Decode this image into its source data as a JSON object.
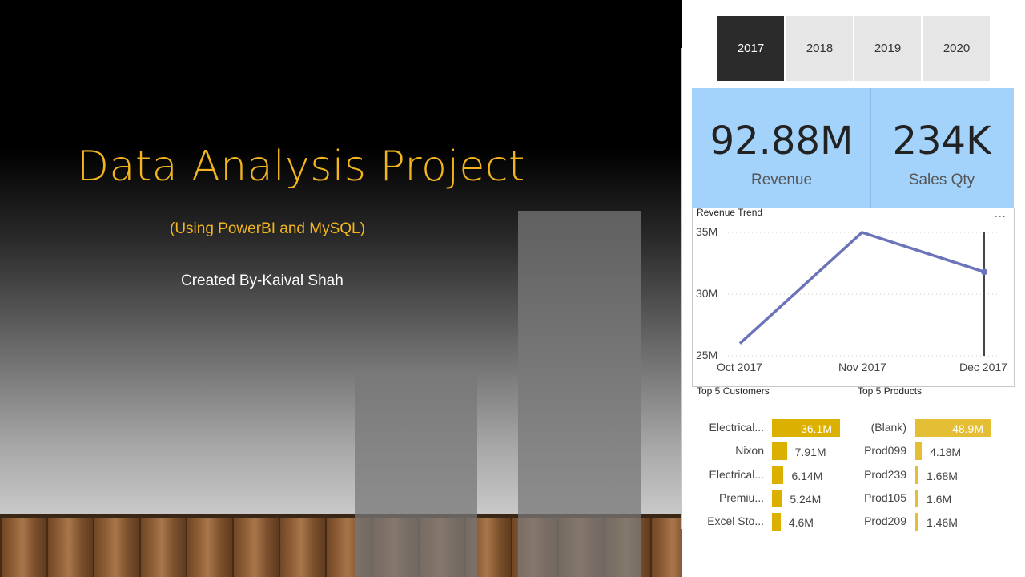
{
  "slide": {
    "title": "Data Analysis Project",
    "subtitle": "(Using PowerBI and MySQL)",
    "creator": "Created By-Kaival Shah"
  },
  "dashboard": {
    "years": [
      "2017",
      "2018",
      "2019",
      "2020"
    ],
    "selected_year": "2017",
    "kpis": {
      "revenue": {
        "value": "92.88M",
        "label": "Revenue"
      },
      "sales_qty": {
        "value": "234K",
        "label": "Sales Qty"
      }
    },
    "more_options": "...",
    "top_customers": {
      "title": "Top 5 Customers",
      "items": [
        {
          "name": "Electrical...",
          "label": "36.1M",
          "value": 36.1
        },
        {
          "name": "Nixon",
          "label": "7.91M",
          "value": 7.91
        },
        {
          "name": "Electrical...",
          "label": "6.14M",
          "value": 6.14
        },
        {
          "name": "Premiu...",
          "label": "5.24M",
          "value": 5.24
        },
        {
          "name": "Excel Sto...",
          "label": "4.6M",
          "value": 4.6
        }
      ]
    },
    "top_products": {
      "title": "Top 5 Products",
      "items": [
        {
          "name": "(Blank)",
          "label": "48.9M",
          "value": 48.9
        },
        {
          "name": "Prod099",
          "label": "4.18M",
          "value": 4.18
        },
        {
          "name": "Prod239",
          "label": "1.68M",
          "value": 1.68
        },
        {
          "name": "Prod105",
          "label": "1.6M",
          "value": 1.6
        },
        {
          "name": "Prod209",
          "label": "1.46M",
          "value": 1.46
        }
      ]
    }
  },
  "chart_data": {
    "type": "line",
    "title": "Revenue Trend",
    "xlabel": "",
    "ylabel": "",
    "categories": [
      "Oct 2017",
      "Nov 2017",
      "Dec 2017"
    ],
    "values": [
      26,
      35,
      31.8
    ],
    "ylim": [
      25,
      35
    ],
    "yticks": [
      "25M",
      "30M",
      "35M"
    ],
    "grid": true,
    "line_color": "#6b74b8"
  },
  "colors": {
    "title_accent": "#f2b51e",
    "kpi_background": "#a3d2fb",
    "bar_color": "#dcb000",
    "selected_year_background": "#2b2b2b"
  }
}
